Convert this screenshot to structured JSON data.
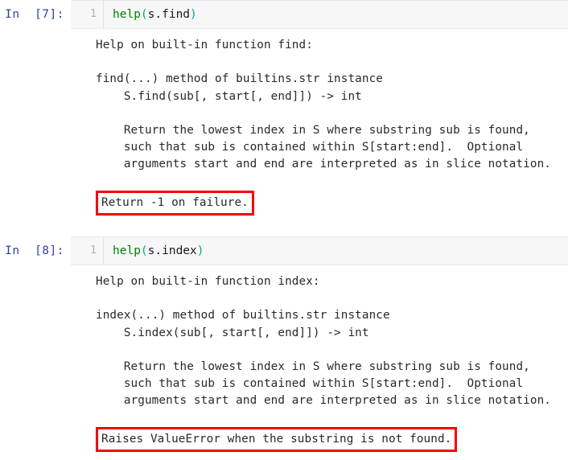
{
  "notebook": {
    "cells": [
      {
        "prompt_label": "In  [7]:",
        "line_number": "1",
        "code": {
          "fn": "help",
          "open_paren": "(",
          "arg": "s.find",
          "close_paren": ")"
        },
        "output_lines": [
          "Help on built-in function find:",
          "",
          "find(...) method of builtins.str instance",
          "    S.find(sub[, start[, end]]) -> int",
          "",
          "    Return the lowest index in S where substring sub is found,",
          "    such that sub is contained within S[start:end].  Optional",
          "    arguments start and end are interpreted as in slice notation."
        ],
        "annotation": {
          "text": "Return -1 on failure.",
          "color": "#fb0007",
          "indent": "    "
        }
      },
      {
        "prompt_label": "In  [8]:",
        "line_number": "1",
        "code": {
          "fn": "help",
          "open_paren": "(",
          "arg": "s.index",
          "close_paren": ")"
        },
        "output_lines": [
          "Help on built-in function index:",
          "",
          "index(...) method of builtins.str instance",
          "    S.index(sub[, start[, end]]) -> int",
          "",
          "    Return the lowest index in S where substring sub is found,",
          "    such that sub is contained within S[start:end].  Optional",
          "    arguments start and end are interpreted as in slice notation."
        ],
        "annotation": {
          "text": "Raises ValueError when the substring is not found.",
          "color": "#fb0007",
          "indent": "    "
        }
      }
    ]
  }
}
